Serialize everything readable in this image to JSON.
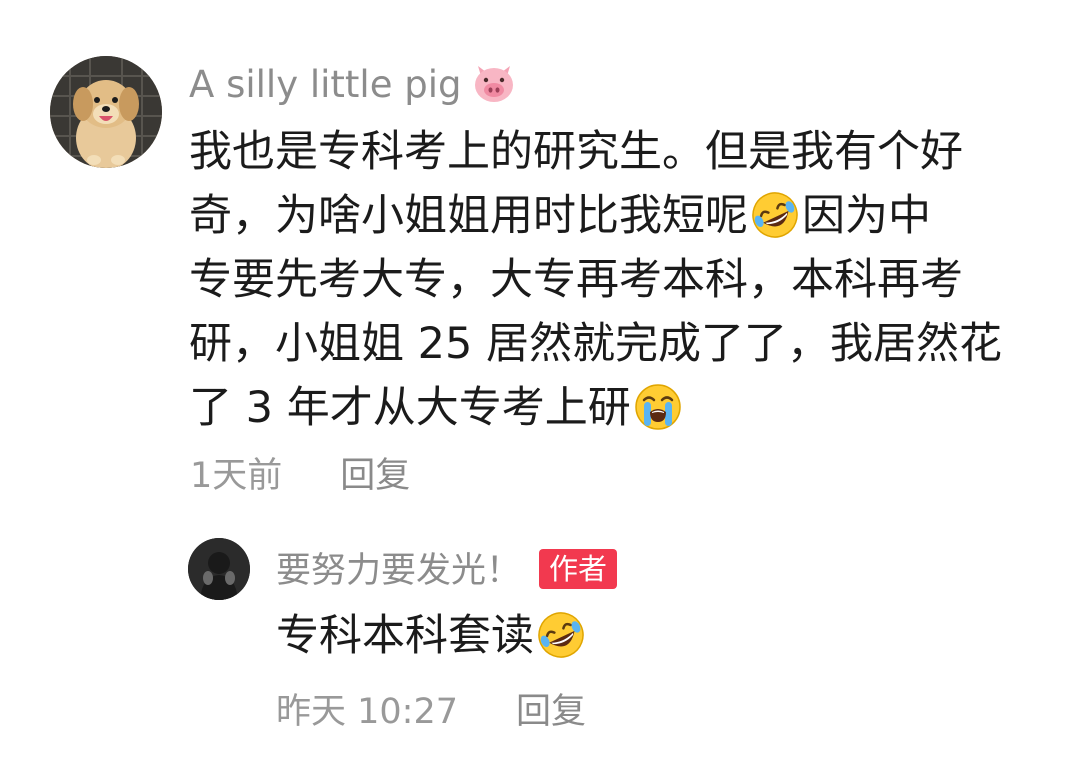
{
  "comment": {
    "username": "A silly little pig",
    "username_icon": "pig-face-emoji",
    "text_lines": [
      "我也是专科考上的研究生。但是我有个好",
      "奇，为啥小姐姐用时比我短呢",
      "因为中",
      "专要先考大专，大专再考本科，本科再考",
      "研，小姐姐 25 居然就完成了了，我居然花",
      "了 3 年才从大专考上研"
    ],
    "emoji_1": "rolling-on-floor-laughing-emoji",
    "emoji_2": "loudly-crying-emoji",
    "time": "1天前",
    "reply_label": "回复"
  },
  "reply": {
    "username": "要努力要发光！",
    "badge": "作者",
    "text": "专科本科套读",
    "emoji": "rolling-on-floor-laughing-emoji",
    "time": "昨天 10:27",
    "reply_label": "回复"
  },
  "colors": {
    "username": "#8c8c8c",
    "meta": "#999999",
    "badge_bg": "#f2394f",
    "text": "#1b1b1b"
  }
}
